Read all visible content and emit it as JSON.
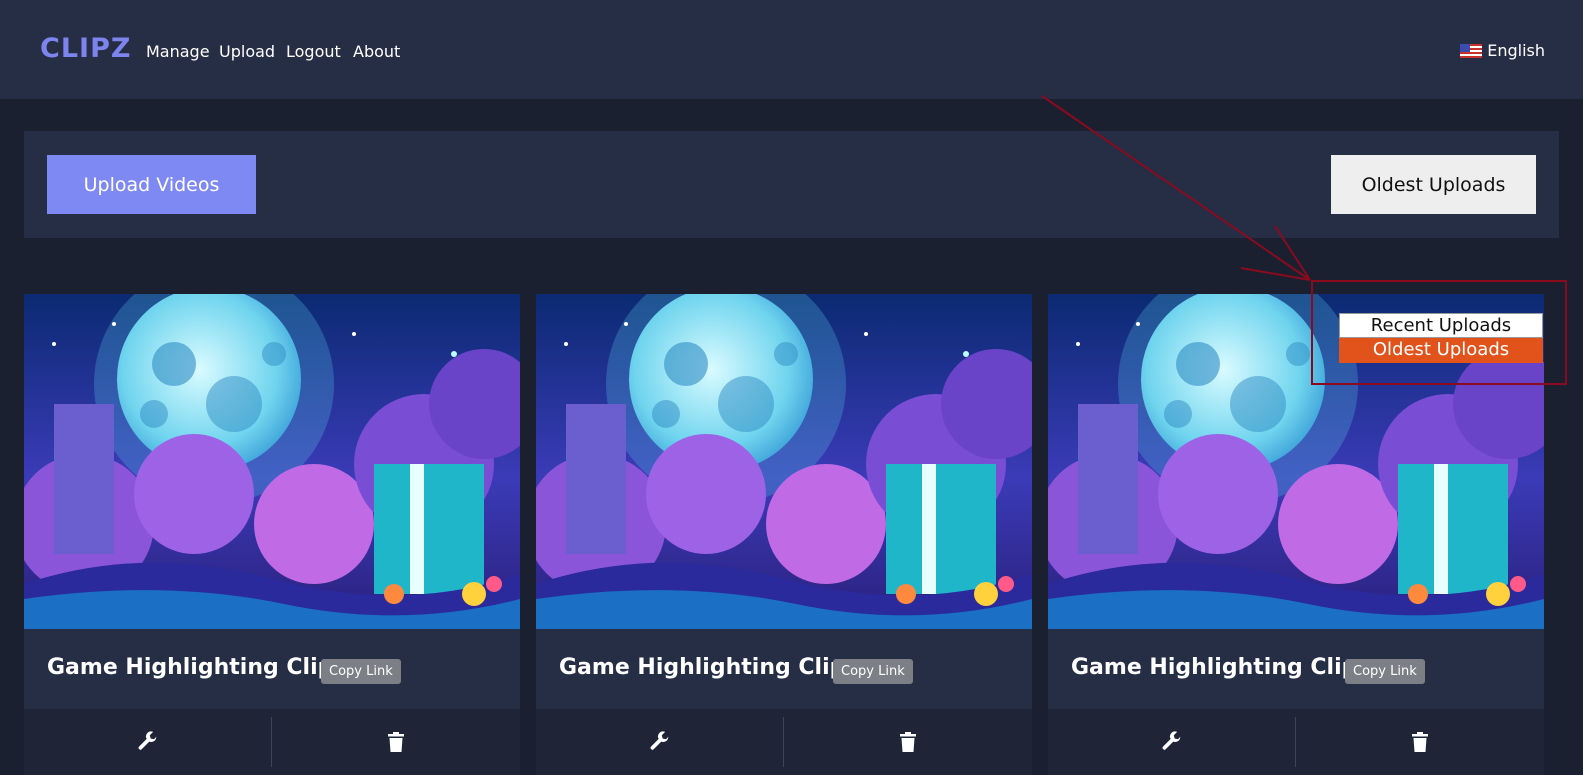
{
  "header": {
    "logo": "CLIPZ",
    "nav": [
      "Manage",
      "Upload",
      "Logout",
      "About"
    ],
    "language": "English"
  },
  "toolbar": {
    "upload_label": "Upload Videos",
    "sort_selected": "Oldest Uploads"
  },
  "sort_dropdown": {
    "options": [
      "Recent Uploads",
      "Oldest Uploads"
    ],
    "highlighted": "Oldest Uploads"
  },
  "clips": [
    {
      "title": "Game Highlighting Clip",
      "copy_label": "Copy Link"
    },
    {
      "title": "Game Highlighting Clip",
      "copy_label": "Copy Link"
    },
    {
      "title": "Game Highlighting Clip",
      "copy_label": "Copy Link"
    }
  ],
  "icons": {
    "edit": "wrench-icon",
    "delete": "trash-icon"
  },
  "colors": {
    "accent": "#7f89f4",
    "header_bg": "#262e45",
    "page_bg": "#1b2030",
    "dropdown_highlight": "#e2531c",
    "annotation": "#8b0a1e"
  }
}
